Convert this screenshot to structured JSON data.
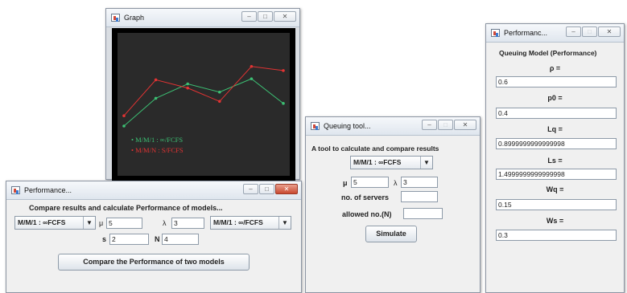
{
  "graph_window": {
    "title": "Graph",
    "legend": [
      "M/M/1 : ∞/FCFS",
      "M/M/N : S/FCFS"
    ],
    "colors": {
      "mm1": "#3cbf73",
      "mmn": "#e23333"
    },
    "chart_data": {
      "type": "line",
      "x": [
        1,
        2,
        3,
        4,
        5,
        6
      ],
      "series": [
        {
          "name": "M/M/1 : ∞/FCFS",
          "values": [
            0.25,
            0.52,
            0.66,
            0.58,
            0.71,
            0.47
          ]
        },
        {
          "name": "M/M/N : S/FCFS",
          "values": [
            0.35,
            0.7,
            0.62,
            0.49,
            0.83,
            0.79
          ]
        }
      ],
      "grid": false,
      "legend_position": "bottom-left"
    }
  },
  "perf_compare_window": {
    "title": "Performance...",
    "heading": "Compare results and calculate Performance of models...",
    "model1": "M/M/1 : ∞FCFS",
    "mu_label": "μ",
    "mu_value": "5",
    "lambda_label": "λ",
    "lambda_value": "3",
    "model2": "M/M/1 : ∞/FCFS",
    "s_label": "s",
    "s_value": "2",
    "n_label": "N",
    "n_value": "4",
    "compare_button": "Compare the Performance of two models"
  },
  "queuing_tool_window": {
    "title": "Queuing tool...",
    "heading": "A tool to calculate and compare results",
    "model": "M/M/1 : ∞FCFS",
    "mu_label": "μ",
    "mu_value": "5",
    "lambda_label": "λ",
    "lambda_value": "3",
    "servers_label": "no. of servers",
    "servers_value": "",
    "allowed_label": "allowed no.(N)",
    "allowed_value": "",
    "simulate_button": "Simulate"
  },
  "perf_model_window": {
    "title": "Performanc...",
    "heading": "Queuing Model (Performance)",
    "fields": [
      {
        "label": "ρ =",
        "value": "0.6"
      },
      {
        "label": "p0 =",
        "value": "0.4"
      },
      {
        "label": "Lq =",
        "value": "0.8999999999999998"
      },
      {
        "label": "Ls =",
        "value": "1.4999999999999998"
      },
      {
        "label": "Wq =",
        "value": "0.15"
      },
      {
        "label": "Ws =",
        "value": "0.3"
      }
    ]
  }
}
